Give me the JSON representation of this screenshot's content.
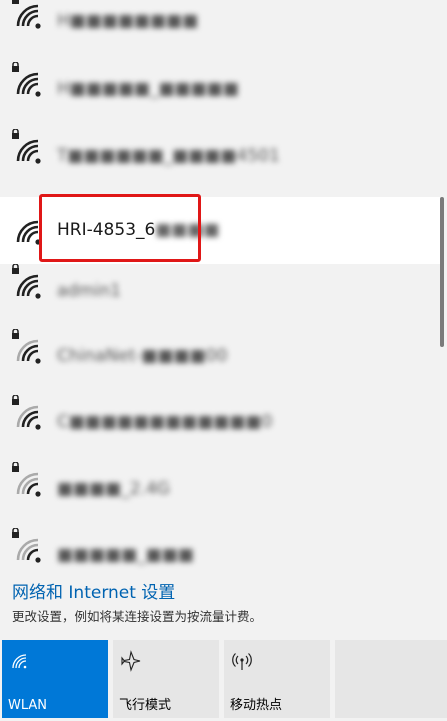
{
  "networks": [
    {
      "name": "H■■■■■■■■",
      "secured": true,
      "blurred": true
    },
    {
      "name": "H■■■■■_■■■■■",
      "secured": true,
      "blurred": true
    },
    {
      "name": "T■■■■■■_■■■■4501",
      "secured": true,
      "blurred": true
    },
    {
      "name": "HRI-4853_6",
      "name_tail": "■■■■",
      "secured": false,
      "selected": true
    },
    {
      "name": "admin1",
      "secured": true,
      "blurred": true
    },
    {
      "name": "ChinaNet-■■■■00",
      "secured": true,
      "blurred": true
    },
    {
      "name": "C■■■■■■■■■■■■0",
      "secured": true,
      "blurred": true
    },
    {
      "name": "■■■■_2.4G",
      "secured": true,
      "blurred": true
    },
    {
      "name": "■■■■■_■■■",
      "secured": true,
      "blurred": true
    }
  ],
  "settings": {
    "title": "网络和 Internet 设置",
    "description": "更改设置，例如将某连接设置为按流量计费。"
  },
  "quick_actions": [
    {
      "label": "WLAN",
      "icon": "wifi-icon",
      "active": true
    },
    {
      "label": "飞行模式",
      "icon": "airplane-icon",
      "active": false
    },
    {
      "label": "移动热点",
      "icon": "hotspot-icon",
      "active": false
    }
  ],
  "colors": {
    "accent": "#0078d7",
    "link": "#0063b1",
    "highlight_border": "#e01717"
  }
}
